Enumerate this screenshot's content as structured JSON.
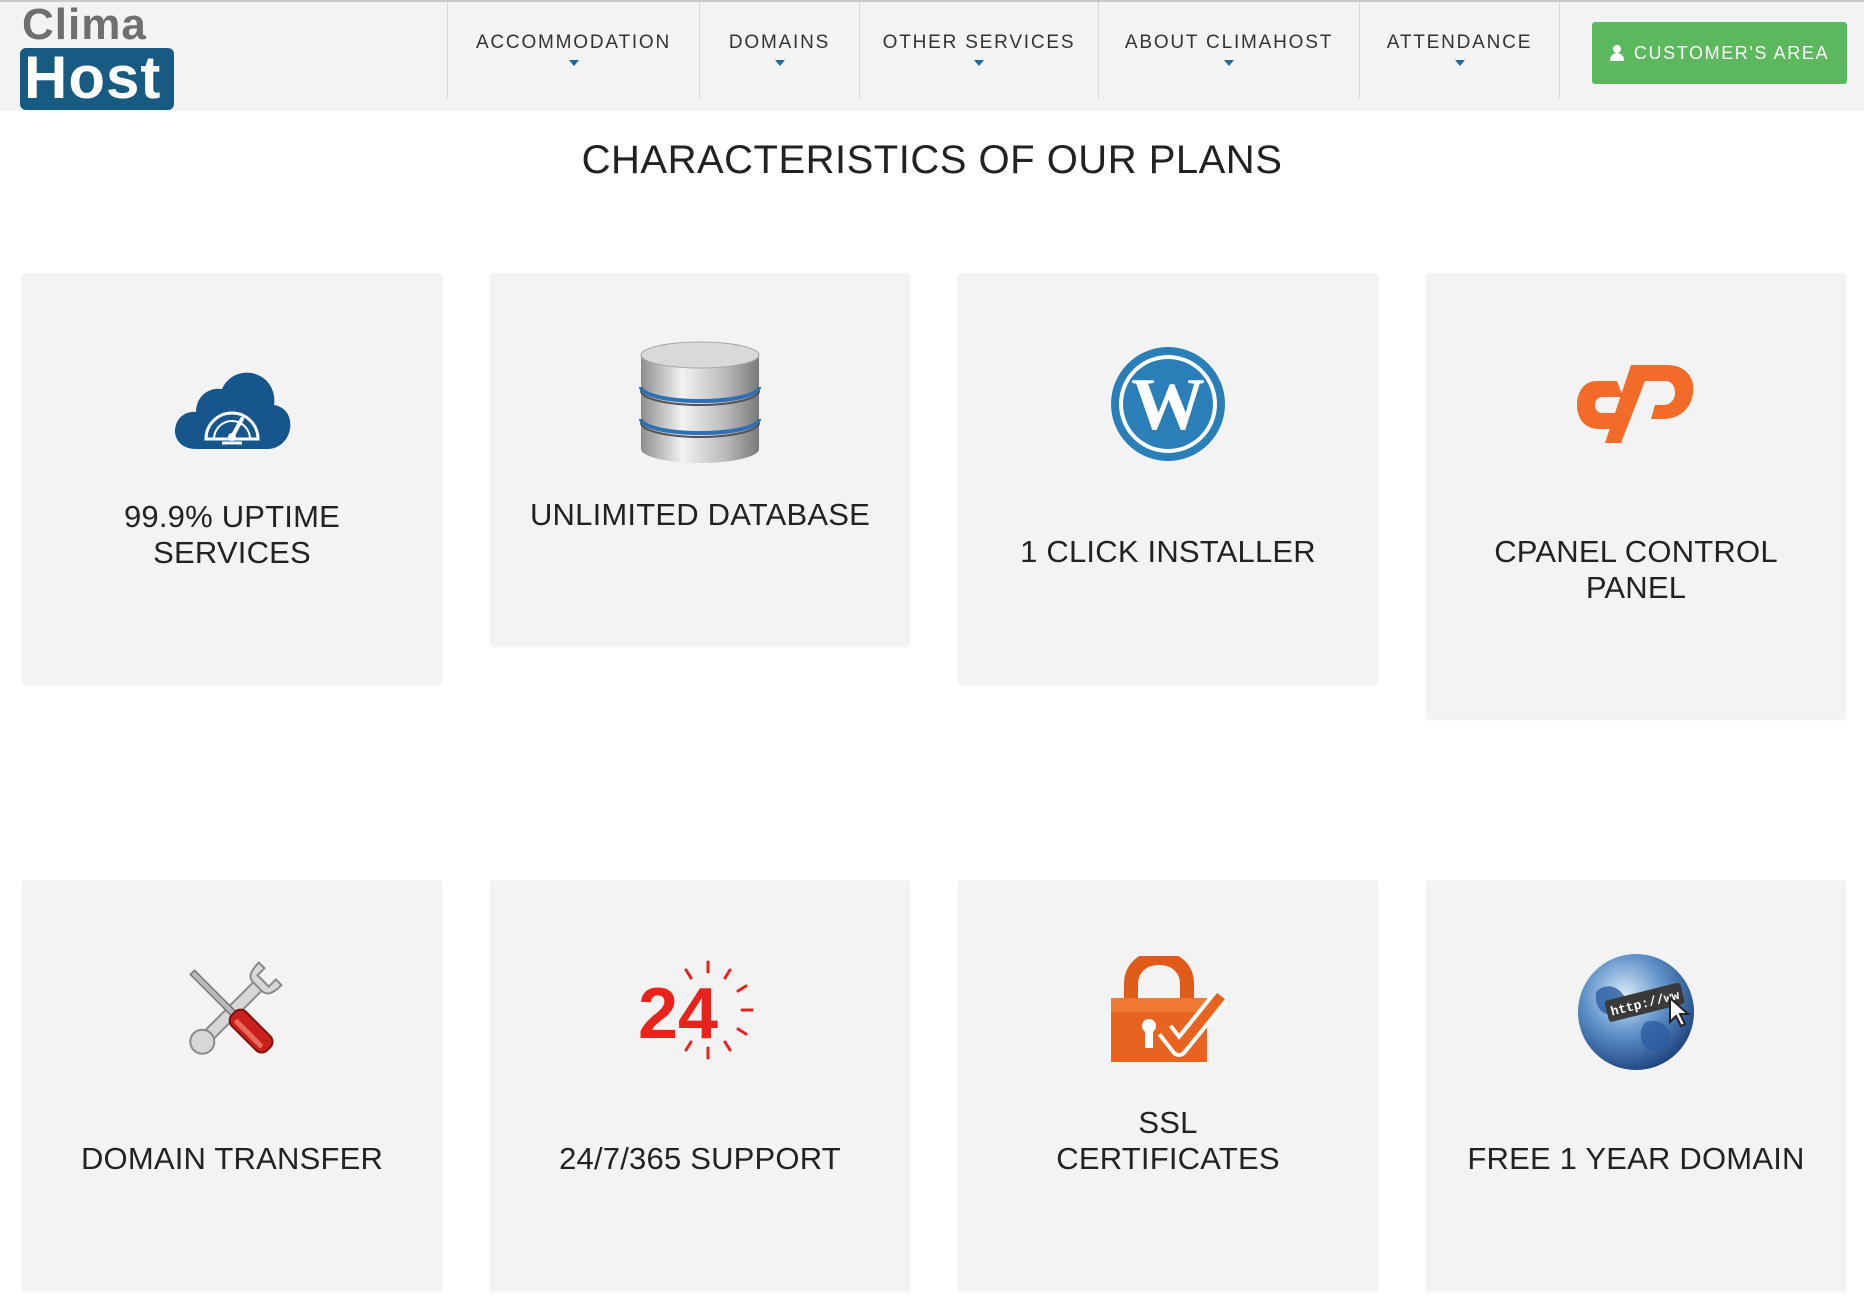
{
  "logo": {
    "top_text": "Clima",
    "bottom_text": "Host"
  },
  "nav": {
    "items": [
      {
        "label": "ACCOMMODATION"
      },
      {
        "label": "DOMAINS"
      },
      {
        "label": "OTHER SERVICES"
      },
      {
        "label": "ABOUT CLIMAHOST"
      },
      {
        "label": "ATTENDANCE"
      }
    ],
    "cta_label": "CUSTOMER'S AREA",
    "cta_icon": "user-icon"
  },
  "main": {
    "title": "CHARACTERISTICS OF OUR PLANS",
    "features": [
      {
        "label_lines": [
          "99.9% UPTIME",
          "SERVICES"
        ],
        "icon": "cloud-speedometer-icon"
      },
      {
        "label_lines": [
          "UNLIMITED DATABASE"
        ],
        "icon": "database-icon"
      },
      {
        "label_lines": [
          "1 CLICK INSTALLER"
        ],
        "icon": "wordpress-icon"
      },
      {
        "label_lines": [
          "CPANEL CONTROL",
          "PANEL"
        ],
        "icon": "cpanel-icon"
      },
      {
        "label_lines": [
          "DOMAIN TRANSFER"
        ],
        "icon": "wrench-screwdriver-icon"
      },
      {
        "label_lines": [
          "24/7/365 SUPPORT"
        ],
        "icon": "support-24-icon",
        "icon_text": "24"
      },
      {
        "label_lines": [
          "SSL",
          "CERTIFICATES"
        ],
        "icon": "padlock-check-icon"
      },
      {
        "label_lines": [
          "FREE 1 YEAR DOMAIN"
        ],
        "icon": "globe-www-icon",
        "icon_text": "http://ww"
      }
    ]
  },
  "colors": {
    "header_bg": "#f3f3f3",
    "card_bg": "#f3f3f3",
    "cta_green": "#5cb85c",
    "logo_blue": "#185b82",
    "accent_blue": "#1c6aa0",
    "cpanel_orange": "#f26b28",
    "support_red": "#e8231c"
  }
}
